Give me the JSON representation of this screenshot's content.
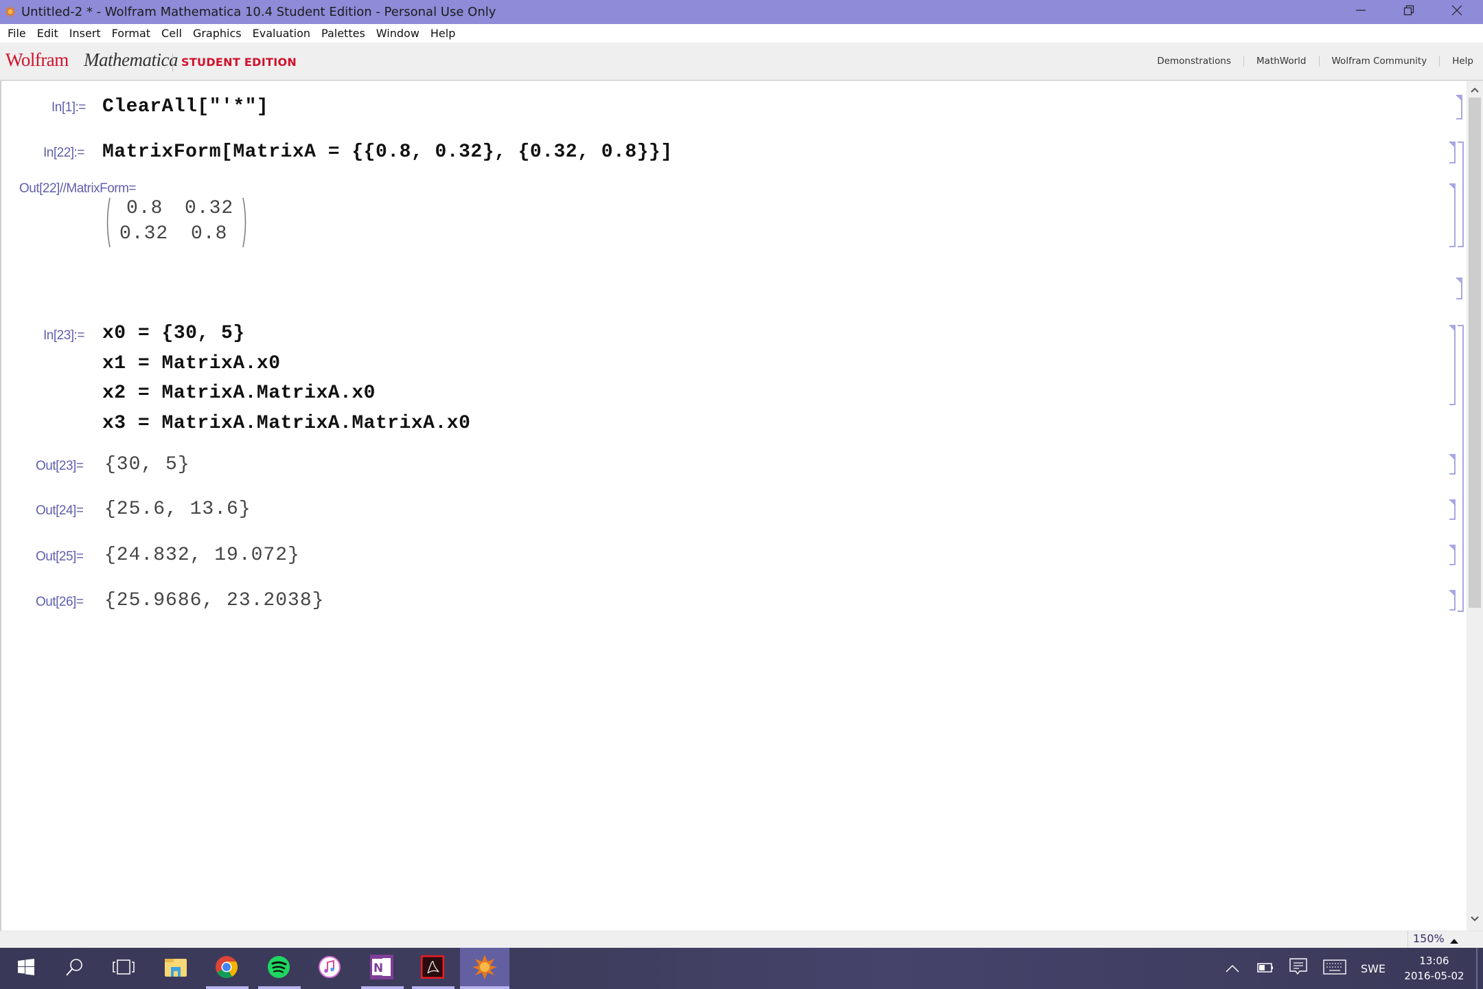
{
  "window": {
    "title": "Untitled-2 * - Wolfram Mathematica 10.4 Student Edition - Personal Use Only",
    "controls": [
      "minimize",
      "restore",
      "close"
    ]
  },
  "menu": [
    "File",
    "Edit",
    "Insert",
    "Format",
    "Cell",
    "Graphics",
    "Evaluation",
    "Palettes",
    "Window",
    "Help"
  ],
  "brand": {
    "wolfram": "Wolfram",
    "mathematica": "Mathematica",
    "edition": "STUDENT EDITION",
    "links": [
      "Demonstrations",
      "MathWorld",
      "Wolfram Community",
      "Help"
    ]
  },
  "notebook": {
    "cells": {
      "in1": {
        "label": "In[1]:=",
        "code": "ClearAll[\"'*\"]"
      },
      "in22": {
        "label": "In[22]:=",
        "code": "MatrixForm[MatrixA = {{0.8, 0.32}, {0.32, 0.8}}]"
      },
      "out22": {
        "label": "Out[22]//MatrixForm=",
        "matrix": [
          [
            "0.8",
            "0.32"
          ],
          [
            "0.32",
            "0.8"
          ]
        ]
      },
      "in23": {
        "label": "In[23]:=",
        "lines": [
          "x0 = {30, 5}",
          "x1 = MatrixA.x0",
          "x2 = MatrixA.MatrixA.x0",
          "x3 = MatrixA.MatrixA.MatrixA.x0"
        ]
      },
      "out23": {
        "label": "Out[23]=",
        "value": "{30, 5}"
      },
      "out24": {
        "label": "Out[24]=",
        "value": "{25.6, 13.6}"
      },
      "out25": {
        "label": "Out[25]=",
        "value": "{24.832, 19.072}"
      },
      "out26": {
        "label": "Out[26]=",
        "value": "{25.9686, 23.2038}"
      }
    }
  },
  "statusbar": {
    "zoom": "150%"
  },
  "taskbar": {
    "apps": [
      "Start",
      "Search",
      "Task View",
      "File Explorer",
      "Google Chrome",
      "Spotify",
      "iTunes",
      "OneNote",
      "Adobe Acrobat",
      "Wolfram Mathematica"
    ],
    "tray": {
      "language": "SWE",
      "time": "13:06",
      "date": "2016-05-02"
    }
  },
  "colors": {
    "titlebar": "#8e8bd8",
    "brand_red": "#d0112b",
    "cell_label": "#5f5faf",
    "bracket": "#a7a7e2",
    "taskbar": "#3a3858"
  }
}
